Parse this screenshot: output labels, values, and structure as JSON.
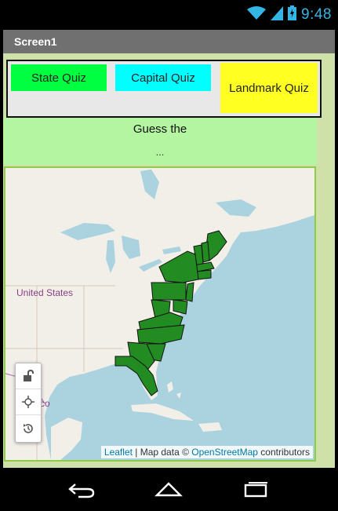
{
  "status_bar": {
    "time": "9:48",
    "icons": [
      "wifi-icon",
      "signal-icon",
      "battery-icon"
    ],
    "color": "#33b5e5"
  },
  "title_bar": {
    "title": "Screen1"
  },
  "buttons": {
    "state_quiz": "State Quiz",
    "capital_quiz": "Capital Quiz",
    "landmark_quiz": "Landmark Quiz"
  },
  "prompt": {
    "title": "Guess the",
    "subtitle": "..."
  },
  "map": {
    "country_label": "United States",
    "partial_label": "co",
    "highlight_color": "#228b22",
    "controls": [
      "lock-icon",
      "locate-icon",
      "reset-icon"
    ],
    "attribution": {
      "leaflet": "Leaflet",
      "separator": " | Map data © ",
      "osm": "OpenStreetMap",
      "suffix": " contributors"
    }
  },
  "nav_bar": {
    "buttons": [
      "back-icon",
      "home-icon",
      "recents-icon"
    ]
  },
  "colors": {
    "state_button": "#00ff40",
    "capital_button": "#00ffff",
    "landmark_button": "#ffff22",
    "prompt_bg": "#b4f5a2",
    "map_border": "#8ecb46"
  }
}
